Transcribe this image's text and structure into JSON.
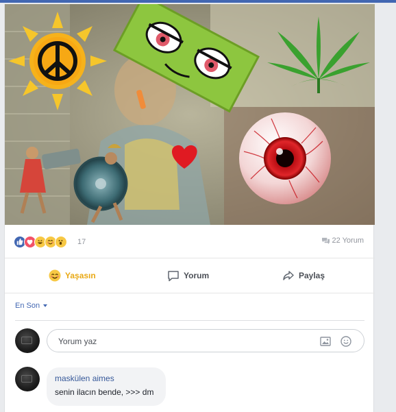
{
  "post": {
    "reactions": {
      "count": "17",
      "types": [
        "like-icon",
        "love-icon",
        "haha-icon",
        "yay-icon",
        "wow-icon"
      ],
      "colors": {
        "like": "#4267b2",
        "love": "#f25268",
        "emoji": "#f7c844"
      }
    },
    "comment_count": "22 Yorum"
  },
  "actions": {
    "yasasin_label": "Yaşasın",
    "yorum_label": "Yorum",
    "paylas_label": "Paylaş",
    "active_color": "#e9a915"
  },
  "comments": {
    "sort_label": "En Son",
    "compose_placeholder": "Yorum yaz",
    "items": [
      {
        "author": "maskülen aimes",
        "text": "senin ilacın bende, >>> dm"
      }
    ]
  },
  "colors": {
    "brand": "#4267b2",
    "link": "#365899",
    "muted": "#90949c"
  }
}
